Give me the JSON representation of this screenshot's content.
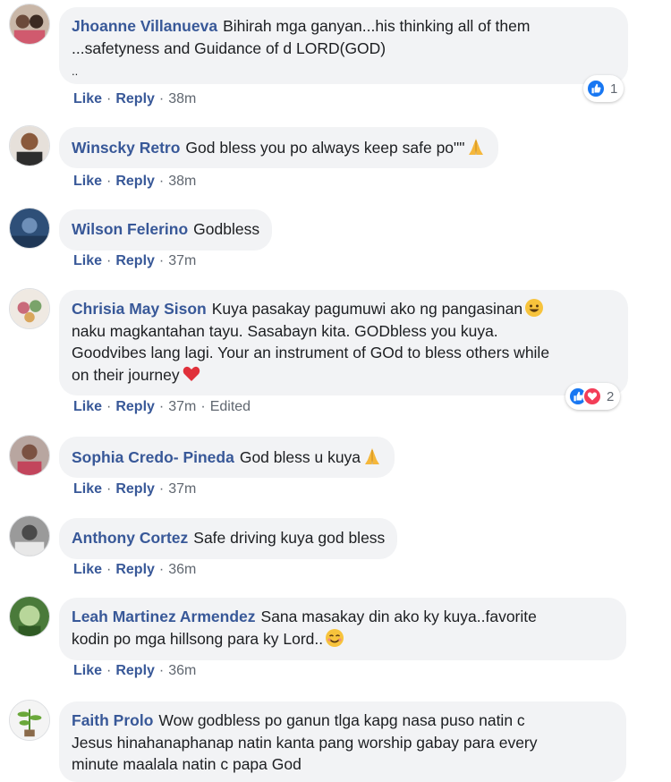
{
  "colors": {
    "author": "#385898",
    "bubble": "#f2f3f5",
    "meta": "#606770",
    "like": "#1877f2",
    "love": "#f33e58"
  },
  "comments": [
    {
      "author": "Jhoanne Villanueva",
      "lines": [
        "Bihirah mga ganyan...his thinking all of them",
        "...safetyness and Guidance of d LORD(GOD)",
        ".."
      ],
      "actions": {
        "like": "Like",
        "reply": "Reply",
        "time": "38m"
      },
      "reactions": {
        "icons": [
          "like-icon"
        ],
        "count": "1"
      }
    },
    {
      "author": "Winscky Retro",
      "lines": [
        "God bless you po always keep safe po\"\""
      ],
      "emoji": "folded-hands-icon",
      "actions": {
        "like": "Like",
        "reply": "Reply",
        "time": "38m"
      }
    },
    {
      "author": "Wilson Felerino",
      "lines": [
        "Godbless"
      ],
      "actions": {
        "like": "Like",
        "reply": "Reply",
        "time": "37m"
      }
    },
    {
      "author": "Chrisia May Sison",
      "lines": [
        "Kuya pasakay pagumuwi ako ng pangasinan",
        "naku magkantahan tayu. Sasabayn kita. GODbless you kuya.",
        "Goodvibes lang lagi. Your an instrument of GOd to bless others while",
        "on their journey"
      ],
      "actions": {
        "like": "Like",
        "reply": "Reply",
        "time": "37m",
        "edited": "Edited"
      },
      "reactions": {
        "icons": [
          "like-icon",
          "love-icon"
        ],
        "count": "2"
      }
    },
    {
      "author": "Sophia Credo- Pineda",
      "lines": [
        "God bless u kuya"
      ],
      "emoji": "folded-hands-icon",
      "actions": {
        "like": "Like",
        "reply": "Reply",
        "time": "37m"
      }
    },
    {
      "author": "Anthony Cortez",
      "lines": [
        "Safe driving kuya god bless"
      ],
      "actions": {
        "like": "Like",
        "reply": "Reply",
        "time": "36m"
      }
    },
    {
      "author": "Leah Martinez Armendez",
      "lines": [
        "Sana masakay din ako ky kuya..favorite",
        "kodin po mga hillsong para ky Lord.."
      ],
      "emoji": "smiling-face-icon",
      "actions": {
        "like": "Like",
        "reply": "Reply",
        "time": "36m"
      }
    },
    {
      "author": "Faith Prolo",
      "lines": [
        "Wow godbless po ganun tlga kapg nasa puso natin c",
        "Jesus hinahanaphanap natin kanta pang worship gabay para every",
        "minute maalala natin c papa God"
      ]
    }
  ]
}
